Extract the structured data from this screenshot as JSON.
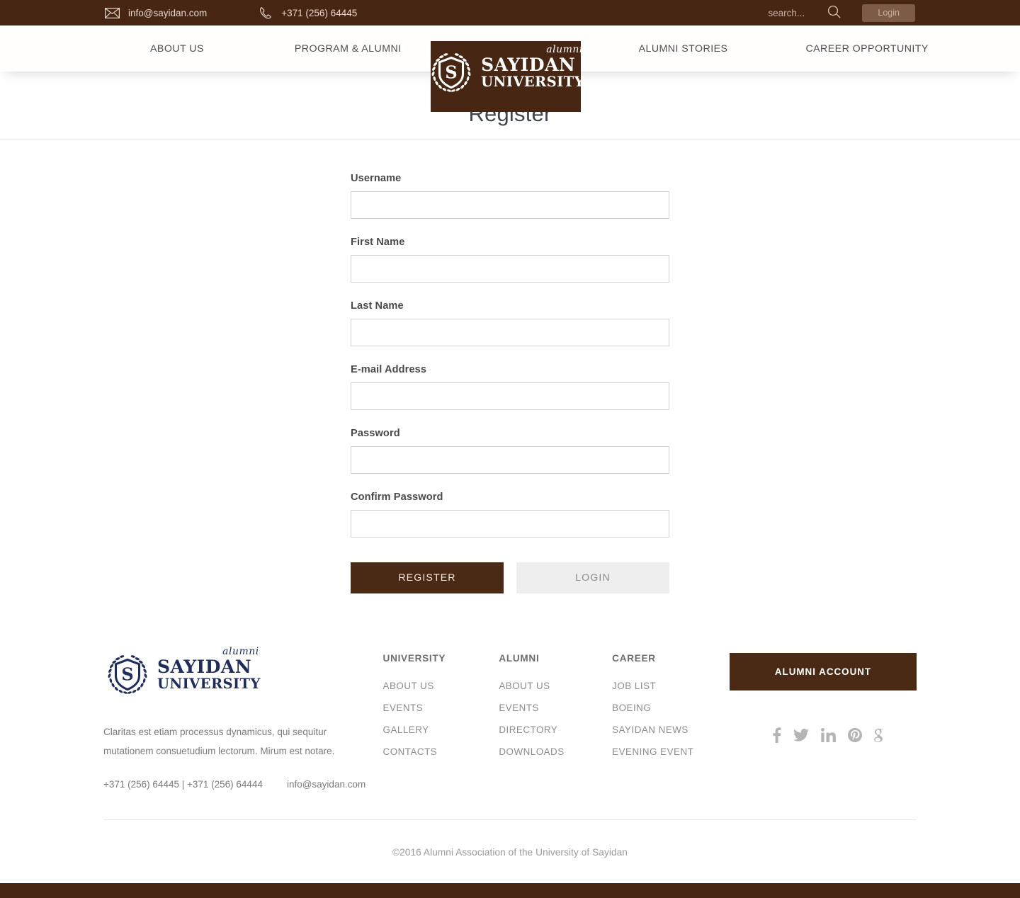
{
  "topbar": {
    "email": "info@sayidan.com",
    "phone": "+371 (256) 64445",
    "mail_icon": "envelope-icon",
    "phone_icon": "phone-icon",
    "search": {
      "placeholder": "search...",
      "value": "",
      "icon": "search-icon"
    },
    "login_label": "Login",
    "bg_color": "#472713"
  },
  "nav": {
    "items": [
      {
        "label": "ABOUT US"
      },
      {
        "label": "PROGRAM & ALUMNI"
      },
      {
        "label": "ALUMNI STORIES"
      },
      {
        "label": "CAREER OPPORTUNITY"
      }
    ]
  },
  "logo": {
    "alumni": "alumni",
    "line1": "SAYIDAN",
    "line2": "UNIVERSITY",
    "monogram": "S",
    "header_color": "#ffffff",
    "footer_color": "#1f2d5c",
    "badge_bg": "#472713"
  },
  "page": {
    "title": "Register"
  },
  "form": {
    "fields": [
      {
        "label": "Username",
        "value": "",
        "placeholder": "",
        "name": "username"
      },
      {
        "label": "First Name",
        "value": "",
        "placeholder": "",
        "name": "first-name"
      },
      {
        "label": "Last Name",
        "value": "",
        "placeholder": "",
        "name": "last-name"
      },
      {
        "label": "E-mail Address",
        "value": "",
        "placeholder": "",
        "name": "email"
      },
      {
        "label": "Password",
        "value": "",
        "placeholder": "",
        "name": "password"
      },
      {
        "label": "Confirm Password",
        "value": "",
        "placeholder": "",
        "name": "confirm-password"
      }
    ],
    "register_label": "REGISTER",
    "login_label": "LOGIN",
    "register_color": "#4a2a14",
    "login_color": "#eeeeee"
  },
  "footer": {
    "description": "Claritas est etiam processus dynamicus, qui sequitur mutationem consuetudium lectorum. Mirum est notare.",
    "phones": "+371 (256) 64445 | +371 (256) 64444",
    "email": "info@sayidan.com",
    "columns": [
      {
        "heading": "UNIVERSITY",
        "links": [
          "ABOUT US",
          "EVENTS",
          "GALLERY",
          "CONTACTS"
        ]
      },
      {
        "heading": "ALUMNI",
        "links": [
          "ABOUT US",
          "EVENTS",
          "DIRECTORY",
          "DOWNLOADS"
        ]
      },
      {
        "heading": "CAREER",
        "links": [
          "JOB LIST",
          "BOEING",
          "SAYIDAN NEWS",
          "EVENING EVENT"
        ]
      }
    ],
    "alumni_account_label": "ALUMNI ACCOUNT",
    "socials": [
      {
        "name": "facebook-icon"
      },
      {
        "name": "twitter-icon"
      },
      {
        "name": "linkedin-icon"
      },
      {
        "name": "pinterest-icon"
      },
      {
        "name": "google-plus-icon"
      }
    ],
    "copyright": "©2016 Alumni Association of the University of Sayidan",
    "accent_color": "#4a2a14",
    "bottom_strip_color": "#472713"
  }
}
